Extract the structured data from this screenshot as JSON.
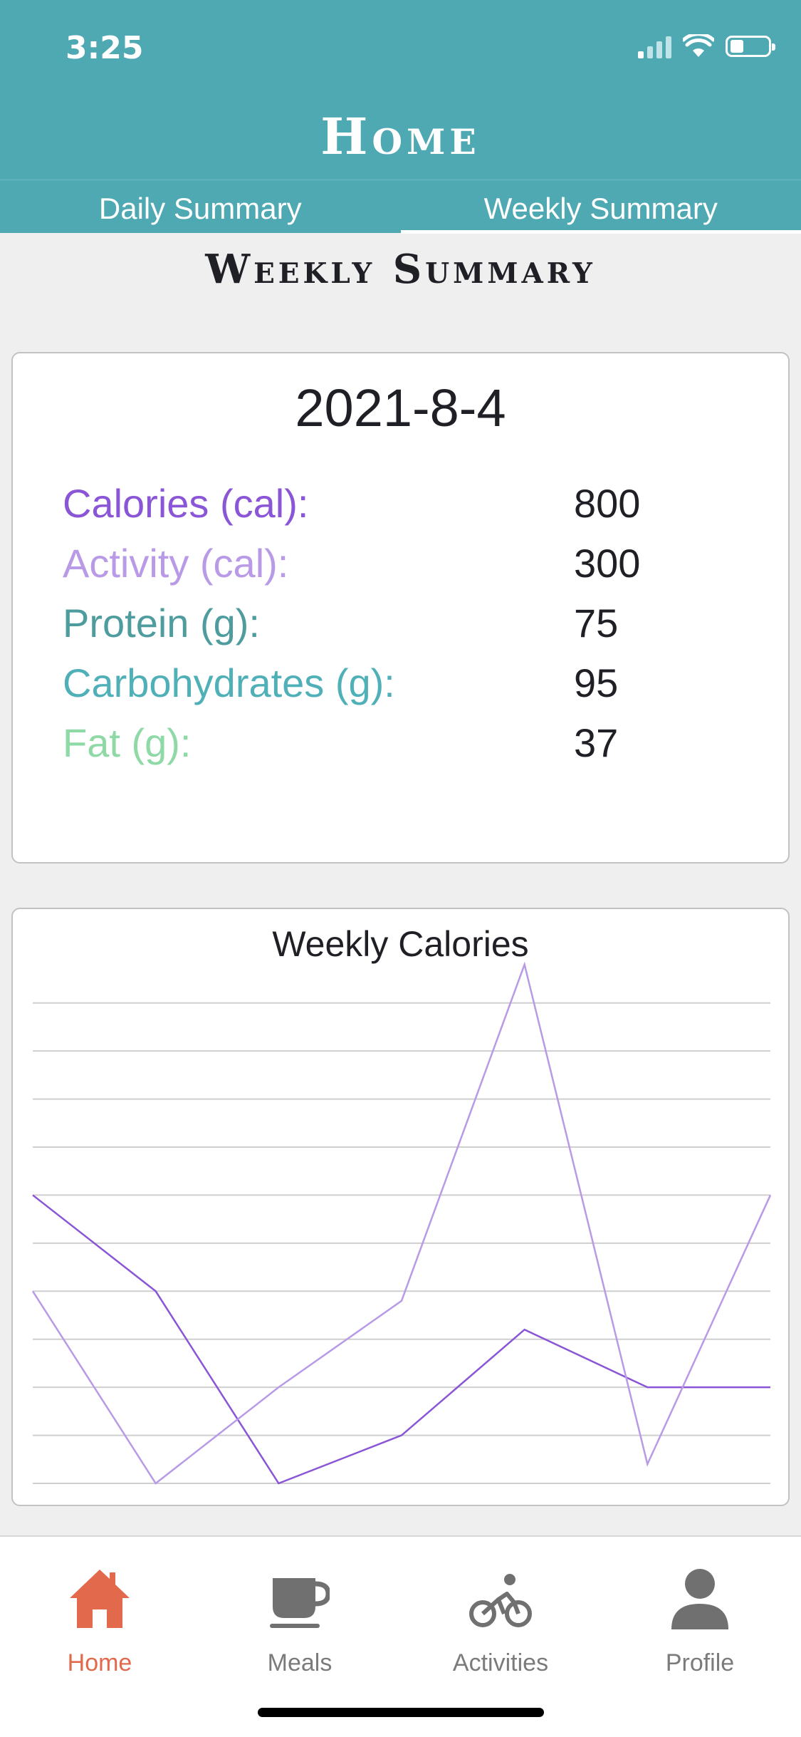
{
  "status_bar": {
    "time": "3:25"
  },
  "header": {
    "title": "Home",
    "tabs": [
      {
        "label": "Daily Summary",
        "active": false
      },
      {
        "label": "Weekly Summary",
        "active": true
      }
    ]
  },
  "section_title": "Weekly Summary",
  "summary": {
    "date": "2021-8-4",
    "rows": [
      {
        "label": "Calories (cal):",
        "value": "800",
        "color": "#8a55d6"
      },
      {
        "label": "Activity (cal):",
        "value": "300",
        "color": "#b89ae6"
      },
      {
        "label": "Protein (g):",
        "value": "75",
        "color": "#4f9c9e"
      },
      {
        "label": "Carbohydrates (g):",
        "value": "95",
        "color": "#4fb0b8"
      },
      {
        "label": "Fat (g):",
        "value": "37",
        "color": "#8ed9a6"
      }
    ]
  },
  "chart_data": {
    "type": "line",
    "title": "Weekly Calories",
    "x": [
      1,
      2,
      3,
      4,
      5,
      6,
      7
    ],
    "ylim": [
      0,
      10.5
    ],
    "grid": true,
    "series": [
      {
        "color": "#8a55d6",
        "values": [
          6,
          4,
          0,
          1,
          3.2,
          2,
          2
        ]
      },
      {
        "color": "#b89ae6",
        "values": [
          4,
          0,
          2,
          3.8,
          10.8,
          0.4,
          6
        ]
      }
    ]
  },
  "tabbar": {
    "items": [
      {
        "label": "Home",
        "icon": "home-icon",
        "active": true
      },
      {
        "label": "Meals",
        "icon": "cup-icon",
        "active": false
      },
      {
        "label": "Activities",
        "icon": "bicycle-icon",
        "active": false
      },
      {
        "label": "Profile",
        "icon": "person-icon",
        "active": false
      }
    ]
  }
}
